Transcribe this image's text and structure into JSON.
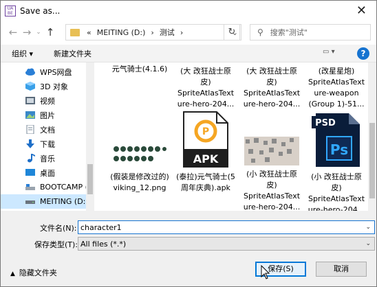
{
  "window": {
    "title": "Save as...",
    "app_icon_text": "UA BE",
    "close_glyph": "✕"
  },
  "address": {
    "prefix": "«",
    "crumbs": [
      "MEITING (D:)",
      "测试"
    ],
    "separator": "›"
  },
  "search": {
    "placeholder": "搜索\"测试\""
  },
  "toolbar": {
    "organize": "组织 ▾",
    "new_folder": "新建文件夹"
  },
  "sidebar": {
    "items": [
      {
        "label": "WPS网盘"
      },
      {
        "label": "3D 对象"
      },
      {
        "label": "视频"
      },
      {
        "label": "图片"
      },
      {
        "label": "文档"
      },
      {
        "label": "下载"
      },
      {
        "label": "音乐"
      },
      {
        "label": "桌面"
      },
      {
        "label": "BOOTCAMP ("
      },
      {
        "label": "MEITING (D:)"
      }
    ]
  },
  "files": [
    {
      "lines": [
        "元气骑士(4.1.6)"
      ]
    },
    {
      "lines": [
        "(大 改狂战士原",
        "皮)",
        "SpriteAtlasText",
        "ure-hero-204..."
      ]
    },
    {
      "lines": [
        "(大 改狂战士原",
        "皮)",
        "SpriteAtlasText",
        "ure-hero-204..."
      ]
    },
    {
      "lines": [
        "(改星星炮)",
        "SpriteAtlasText",
        "ure-weapon",
        "(Group 1)-51..."
      ]
    },
    {
      "lines": [
        "(假装是修改过的)",
        "viking_12.png"
      ]
    },
    {
      "lines": [
        "(泰拉)元气骑士(5",
        "周年庆典).apk"
      ],
      "badge": "APK"
    },
    {
      "lines": [
        "(小 改狂战士原",
        "皮)",
        "SpriteAtlasText",
        "ure-hero-204..."
      ]
    },
    {
      "lines": [
        "(小 改狂战士原",
        "皮)",
        "SpriteAtlasText",
        "ure-hero-204..."
      ],
      "badge": "PSD"
    }
  ],
  "form": {
    "filename_label": "文件名(N):",
    "filename_value": "character1",
    "filetype_label": "保存类型(T):",
    "filetype_value": "All files (*.*)"
  },
  "footer": {
    "hide_folders": "隐藏文件夹",
    "save": "保存(S)",
    "cancel": "取消"
  },
  "colors": {
    "accent": "#0078d7",
    "selection": "#cce8ff",
    "folder": "#e8bf55"
  }
}
